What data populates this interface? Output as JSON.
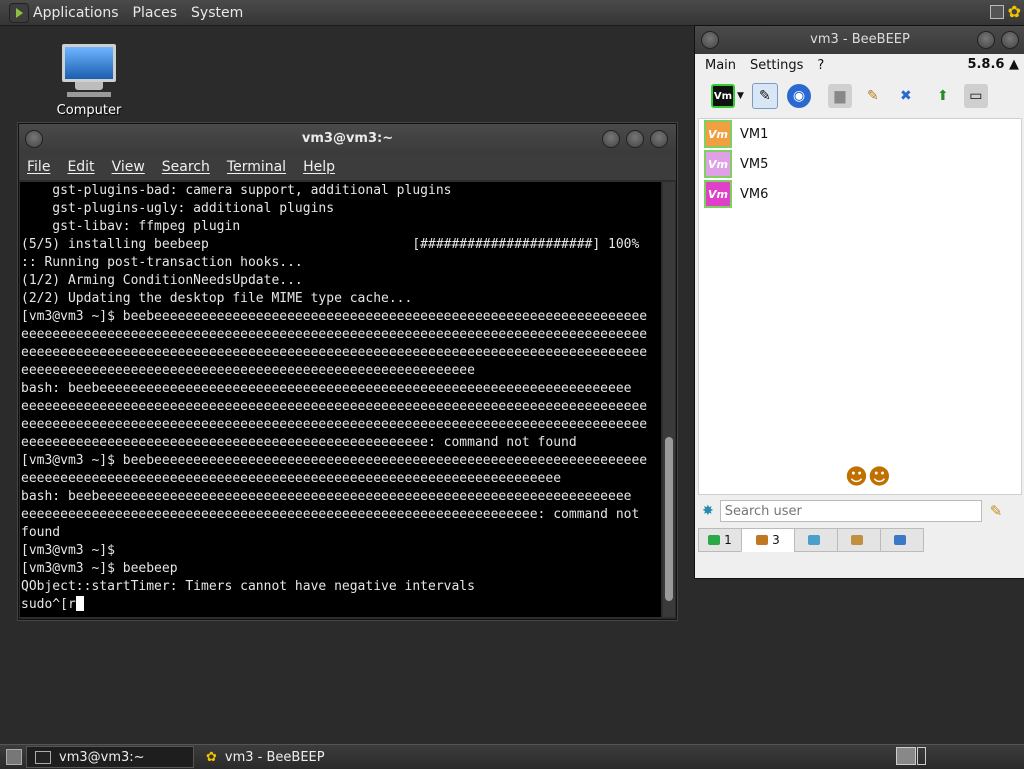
{
  "top_panel": {
    "menus": [
      "Applications",
      "Places",
      "System"
    ]
  },
  "desktop": {
    "icon_label": "Computer"
  },
  "terminal": {
    "title": "vm3@vm3:~",
    "menu": [
      "File",
      "Edit",
      "View",
      "Search",
      "Terminal",
      "Help"
    ],
    "lines": [
      "    gst-plugins-bad: camera support, additional plugins",
      "    gst-plugins-ugly: additional plugins",
      "    gst-libav: ffmpeg plugin",
      "(5/5) installing beebeep                          [######################] 100%",
      ":: Running post-transaction hooks...",
      "(1/2) Arming ConditionNeedsUpdate...",
      "(2/2) Updating the desktop file MIME type cache...",
      "[vm3@vm3 ~]$ beebeeeeeeeeeeeeeeeeeeeeeeeeeeeeeeeeeeeeeeeeeeeeeeeeeeeeeeeeeeeeeee",
      "eeeeeeeeeeeeeeeeeeeeeeeeeeeeeeeeeeeeeeeeeeeeeeeeeeeeeeeeeeeeeeeeeeeeeeeeeeeeeeee",
      "eeeeeeeeeeeeeeeeeeeeeeeeeeeeeeeeeeeeeeeeeeeeeeeeeeeeeeeeeeeeeeeeeeeeeeeeeeeeeeee",
      "eeeeeeeeeeeeeeeeeeeeeeeeeeeeeeeeeeeeeeeeeeeeeeeeeeeeeeeeee",
      "bash: beebeeeeeeeeeeeeeeeeeeeeeeeeeeeeeeeeeeeeeeeeeeeeeeeeeeeeeeeeeeeeeeeeeeee",
      "eeeeeeeeeeeeeeeeeeeeeeeeeeeeeeeeeeeeeeeeeeeeeeeeeeeeeeeeeeeeeeeeeeeeeeeeeeeeeeee",
      "eeeeeeeeeeeeeeeeeeeeeeeeeeeeeeeeeeeeeeeeeeeeeeeeeeeeeeeeeeeeeeeeeeeeeeeeeeeeeeee",
      "eeeeeeeeeeeeeeeeeeeeeeeeeeeeeeeeeeeeeeeeeeeeeeeeeeee: command not found",
      "[vm3@vm3 ~]$ beebeeeeeeeeeeeeeeeeeeeeeeeeeeeeeeeeeeeeeeeeeeeeeeeeeeeeeeeeeeeeeee",
      "eeeeeeeeeeeeeeeeeeeeeeeeeeeeeeeeeeeeeeeeeeeeeeeeeeeeeeeeeeeeeeeeeeeee",
      "bash: beebeeeeeeeeeeeeeeeeeeeeeeeeeeeeeeeeeeeeeeeeeeeeeeeeeeeeeeeeeeeeeeeeeeee",
      "eeeeeeeeeeeeeeeeeeeeeeeeeeeeeeeeeeeeeeeeeeeeeeeeeeeeeeeeeeeeeeeeee: command not",
      "found",
      "[vm3@vm3 ~]$",
      "[vm3@vm3 ~]$ beebeep",
      "QObject::startTimer: Timers cannot have negative intervals"
    ],
    "prompt_line": "sudo^[r"
  },
  "beebeep": {
    "title": "vm3 - BeeBEEP",
    "menu": [
      "Main",
      "Settings",
      "?"
    ],
    "version": "5.8.6",
    "avatar_text": "Vm",
    "users": [
      {
        "name": "VM1",
        "color": "#f0a040",
        "border": "#7fd060"
      },
      {
        "name": "VM5",
        "color": "#e0a0e8",
        "border": "#7fd060"
      },
      {
        "name": "VM6",
        "color": "#e040c8",
        "border": "#7fd060"
      }
    ],
    "search_placeholder": "Search user",
    "tabs": [
      {
        "label": "1",
        "color": "#2aa84a"
      },
      {
        "label": "3",
        "color": "#c07820"
      },
      {
        "label": "",
        "color": "#4aa0c8"
      },
      {
        "label": "",
        "color": "#c09040"
      },
      {
        "label": "",
        "color": "#3a78c8"
      }
    ]
  },
  "taskbar": {
    "items": [
      "vm3@vm3:~",
      "vm3 - BeeBEEP"
    ]
  }
}
